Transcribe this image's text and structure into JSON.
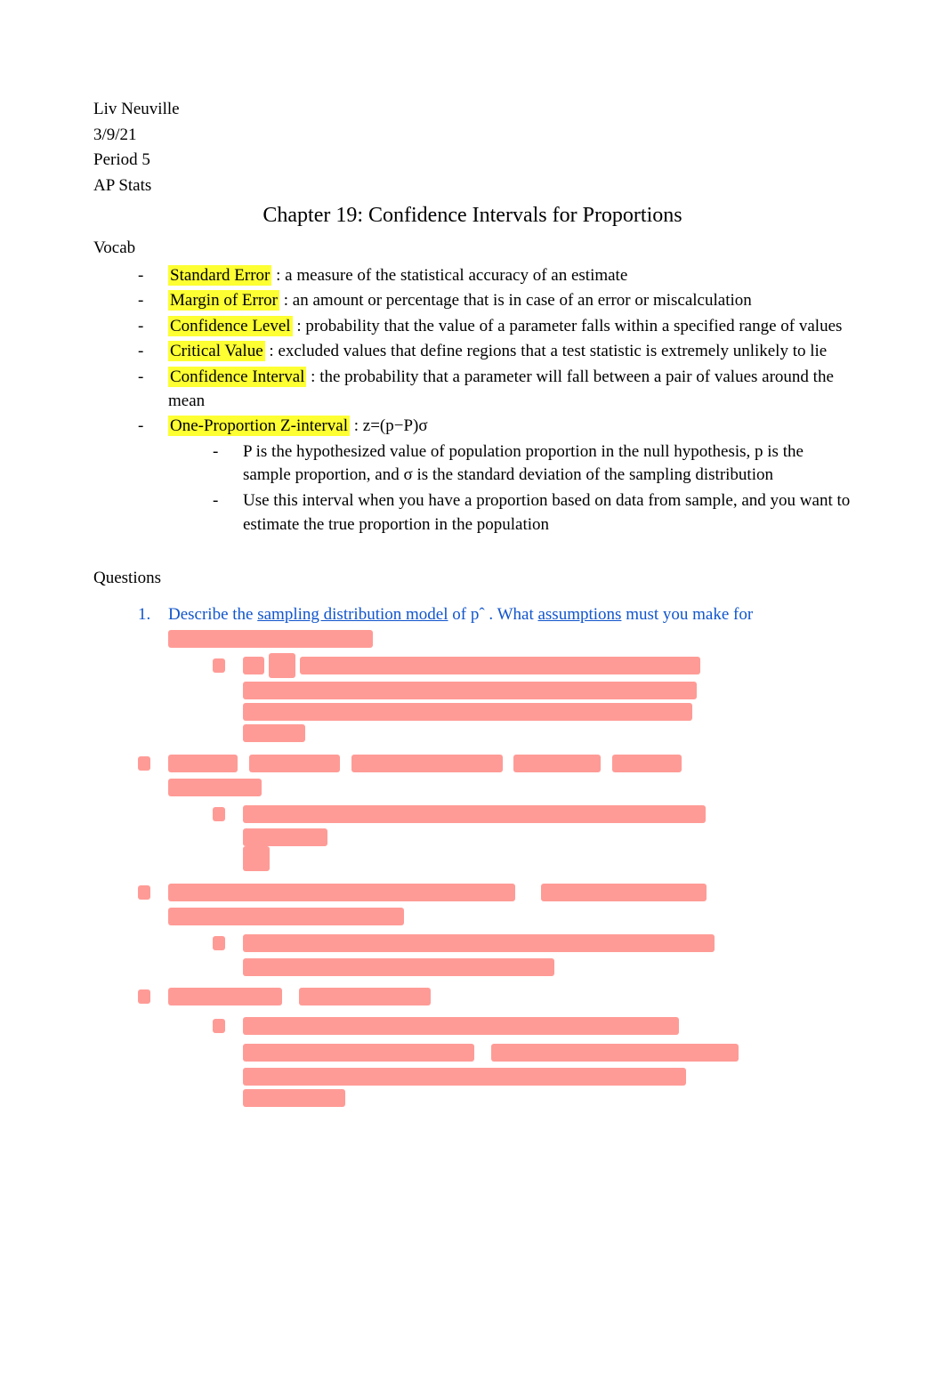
{
  "header": {
    "name": "Liv Neuville",
    "date": "3/9/21",
    "period": "Period 5",
    "course": "AP Stats"
  },
  "title": "Chapter 19: Confidence Intervals for Proportions",
  "vocab_heading": "Vocab",
  "vocab": [
    {
      "term": "Standard Error",
      "sep": " : ",
      "definition": "a measure of the statistical accuracy of an estimate"
    },
    {
      "term": "Margin of Error",
      "sep": " : ",
      "definition": "an amount or percentage that is in case of an error or miscalculation"
    },
    {
      "term": "Confidence Level",
      "sep": "  : ",
      "definition": "probability that the value of a parameter falls within a specified range of values"
    },
    {
      "term": "Critical Value",
      "sep": " : ",
      "definition": "excluded values that define regions that a test statistic is extremely unlikely to lie"
    },
    {
      "term": "Confidence Interval",
      "sep": " : ",
      "definition": "the  probability that a parameter will fall between a pair of values around the mean"
    },
    {
      "term": "One-Proportion Z-interval",
      "sep": "  : ",
      "definition": "z=(p−P)σ",
      "subs": [
        "P is the hypothesized value of population proportion in the null hypothesis, p is the sample proportion, and σ is the standard deviation of the sampling distribution",
        "Use this interval when you have a proportion based on data from sample, and you want to estimate the true proportion in the population"
      ]
    }
  ],
  "questions_heading": "Questions",
  "questions": [
    {
      "num": "1.",
      "prompt_parts": [
        {
          "text": "Describe the  ",
          "u": false
        },
        {
          "text": "sampling distribution model",
          "u": true
        },
        {
          "text": "   of pˆ . What ",
          "u": false
        },
        {
          "text": "assumptions",
          "u": true
        },
        {
          "text": "   must you make for ",
          "u": false
        }
      ]
    }
  ]
}
